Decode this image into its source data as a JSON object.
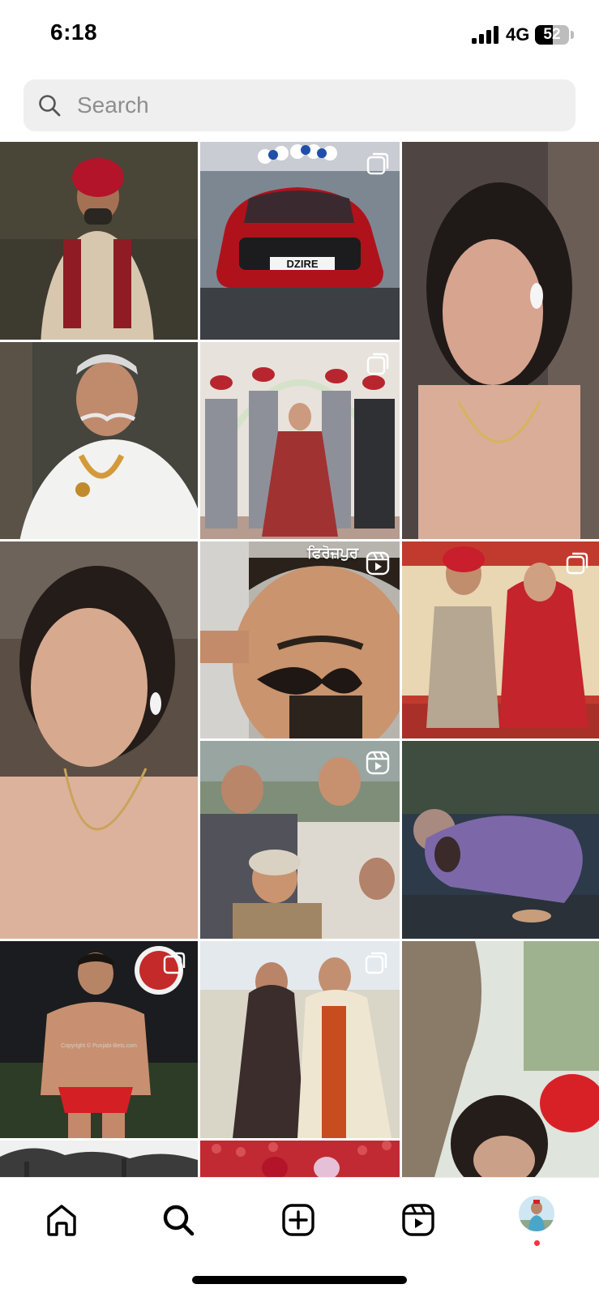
{
  "status_bar": {
    "time": "6:18",
    "network": "4G",
    "battery_percent": "52",
    "battery_level": 0.52
  },
  "search": {
    "placeholder": "Search",
    "value": ""
  },
  "explore_grid": {
    "tiles": [
      {
        "subject": "man in red turban and embroidered sherwani",
        "badge": "none",
        "palette": [
          "#3d3a30",
          "#c7b59a",
          "#b3142a"
        ]
      },
      {
        "subject": "red car DZIRE at dealership",
        "badge": "carousel",
        "plate_text": "DZIRE",
        "palette": [
          "#6c7a86",
          "#b0121c",
          "#2b2b2b"
        ]
      },
      {
        "subject": "woman with earbud and necklace",
        "badge": "none",
        "palette": [
          "#4f4643",
          "#d6a48f",
          "#e6d2c6"
        ]
      },
      {
        "subject": "elderly man with moustache and garland",
        "badge": "none",
        "palette": [
          "#45453e",
          "#f2f2f0",
          "#d39a3a"
        ]
      },
      {
        "subject": "wedding group with bride under floral arch",
        "badge": "carousel",
        "palette": [
          "#e8e2dc",
          "#a13232",
          "#8c8c96"
        ]
      },
      {
        "subject": "woman looking sad with earbud",
        "badge": "none",
        "palette": [
          "#5a4e45",
          "#d7a98f",
          "#e9d2c2"
        ]
      },
      {
        "subject": "man with twirled moustache",
        "badge": "reel",
        "caption": "ਫਿਰੋਜ਼ਪੁਰ",
        "palette": [
          "#b7b4ae",
          "#c9946e",
          "#2a211b"
        ]
      },
      {
        "subject": "couple in wedding attire",
        "badge": "carousel",
        "palette": [
          "#c23a2e",
          "#e9d6b3",
          "#b5a792"
        ]
      },
      {
        "subject": "group of men smiling outdoors",
        "badge": "reel",
        "palette": [
          "#7f8e78",
          "#ded9d0",
          "#51525a"
        ]
      },
      {
        "subject": "animated man lying on ground in purple",
        "badge": "none",
        "palette": [
          "#2d3a4a",
          "#7c68a8",
          "#c79d7c"
        ]
      },
      {
        "subject": "wrestler in red shorts",
        "badge": "carousel",
        "watermark": "Copyright © Punjabi-Bets.com",
        "palette": [
          "#1b1c1f",
          "#c89070",
          "#d41f24"
        ]
      },
      {
        "subject": "two women in shawls",
        "badge": "carousel",
        "palette": [
          "#d9d5c7",
          "#c74d1f",
          "#efe6d2"
        ]
      },
      {
        "subject": "tree trunk and woman",
        "badge": "none",
        "palette": [
          "#dfe4dd",
          "#8a7a68",
          "#d82127"
        ]
      },
      {
        "subject": "trees and sky",
        "badge": "none",
        "palette": [
          "#f0f0f0",
          "#3b3b3b",
          "#8f8f8f"
        ]
      },
      {
        "subject": "red flowers with people in turbans",
        "badge": "none",
        "palette": [
          "#c12a32",
          "#d84f56",
          "#e6c0d6"
        ]
      }
    ]
  },
  "bottom_nav": {
    "items": [
      {
        "name": "home",
        "icon": "home-icon"
      },
      {
        "name": "search",
        "icon": "search-icon",
        "active": true
      },
      {
        "name": "create",
        "icon": "plus-square-icon"
      },
      {
        "name": "reels",
        "icon": "reels-icon"
      },
      {
        "name": "profile",
        "icon": "avatar"
      }
    ]
  },
  "colors": {
    "background": "#ffffff",
    "search_bg": "#efefef",
    "placeholder": "#8e8e8e",
    "notification": "#ff3040"
  }
}
